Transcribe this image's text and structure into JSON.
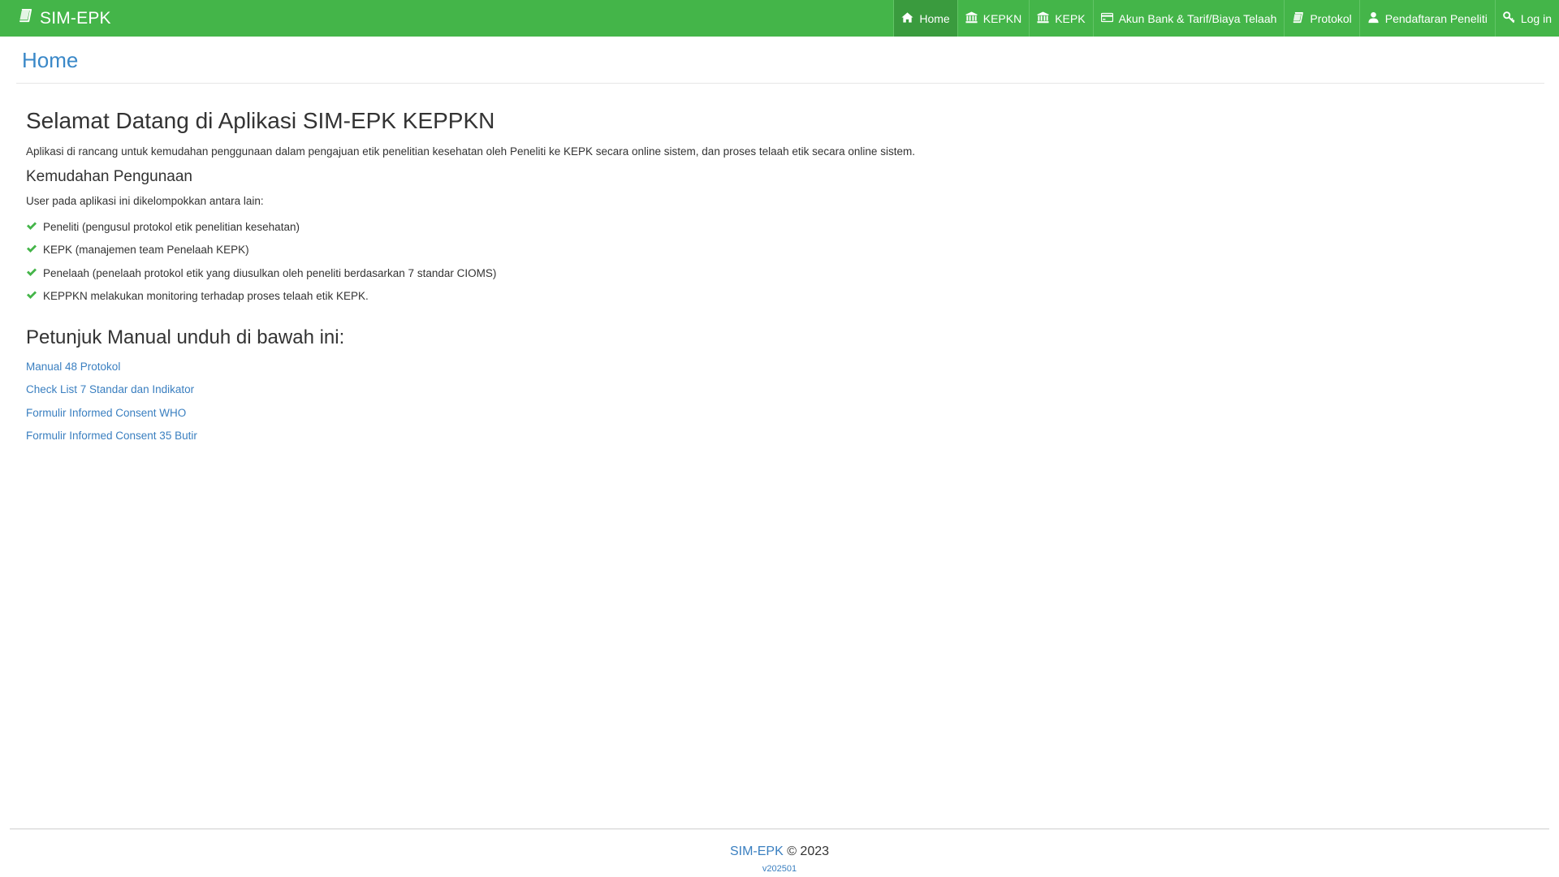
{
  "navbar": {
    "brand": {
      "label": "SIM-EPK",
      "icon": "book-icon"
    },
    "items": [
      {
        "label": "Home",
        "icon": "home-icon",
        "active": true
      },
      {
        "label": "KEPKN",
        "icon": "institution-icon",
        "active": false
      },
      {
        "label": "KEPK",
        "icon": "institution-icon",
        "active": false
      },
      {
        "label": "Akun Bank & Tarif/Biaya Telaah",
        "icon": "credit-card-icon",
        "active": false
      },
      {
        "label": "Protokol",
        "icon": "book-icon",
        "active": false
      },
      {
        "label": "Pendaftaran Peneliti",
        "icon": "user-icon",
        "active": false
      },
      {
        "label": "Log in",
        "icon": "key-icon",
        "active": false
      }
    ],
    "colors": {
      "background": "#44b549",
      "active": "#3a9b3e"
    }
  },
  "page": {
    "title": "Home"
  },
  "content": {
    "welcome_heading": "Selamat Datang di Aplikasi SIM-EPK KEPPKN",
    "intro": "Aplikasi di rancang untuk kemudahan penggunaan dalam pengajuan etik penelitian kesehatan oleh Peneliti ke KEPK secara online sistem, dan proses telaah etik secara online sistem.",
    "ease_heading": "Kemudahan Pengunaan",
    "user_intro": "User pada aplikasi ini dikelompokkan antara lain:",
    "roles": [
      "Peneliti (pengusul protokol etik penelitian kesehatan)",
      "KEPK (manajemen team Penelaah KEPK)",
      "Penelaah (penelaah protokol etik yang diusulkan oleh peneliti berdasarkan 7 standar CIOMS)",
      "KEPPKN melakukan monitoring terhadap proses telaah etik KEPK."
    ],
    "roles_icon": "check-icon",
    "manual_heading": "Petunjuk Manual unduh di bawah ini:",
    "manual_links": [
      "Manual 48 Protokol",
      "Check List 7 Standar dan Indikator",
      "Formulir Informed Consent WHO",
      "Formulir Informed Consent 35 Butir"
    ]
  },
  "footer": {
    "brand": "SIM-EPK",
    "copyright": " © 2023",
    "version": "v202501"
  }
}
